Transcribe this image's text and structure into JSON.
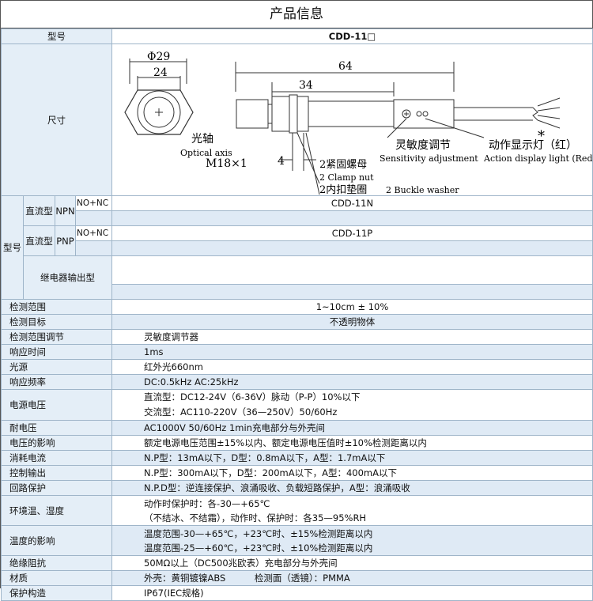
{
  "header": {
    "title": "产品信息"
  },
  "model_row": {
    "label": "型号",
    "value": "CDD-11□"
  },
  "dimension_row": {
    "label": "尺寸",
    "drawing": {
      "dia29": "Φ29",
      "dim24": "24",
      "dim64": "64",
      "dim34": "34",
      "dim4": "4",
      "thread": "M18×1",
      "axis_cn": "光轴",
      "axis_en": "Optical axis",
      "sens_cn": "灵敏度调节",
      "sens_en": "Sensitivity adjustment",
      "action_cn": "动作显示灯（红）",
      "action_en": "Action display light (Red",
      "star": "*",
      "nut_cn": "2紧固螺母",
      "nut_en": "2 Clamp nut",
      "washer_cn": "2内扣垫圈",
      "washer_en": "2 Buckle washer"
    }
  },
  "models": {
    "label": "型号",
    "dc_label": "直流型",
    "npn": "NPN",
    "pnp": "PNP",
    "nonc": "NO+NC",
    "npn_model": "CDD-11N",
    "pnp_model": "CDD-11P",
    "relay_label": "继电器输出型"
  },
  "specs": [
    {
      "label": "检测范围",
      "value": "1~10cm ± 10%",
      "center": true
    },
    {
      "label": "检测目标",
      "value": "不透明物体",
      "center": true
    },
    {
      "label": "检测范围调节",
      "value": "灵敏度调节器"
    },
    {
      "label": "响应时间",
      "value": "1ms"
    },
    {
      "label": "光源",
      "value": "红外光660nm"
    },
    {
      "label": "响应频率",
      "value": "DC:0.5kHz AC:25kHz"
    }
  ],
  "power": {
    "label": "电源电压",
    "line1": "直流型：DC12-24V（6-36V）脉动（P-P）10%以下",
    "line2": "交流型：AC110-220V（36—250V）50/60Hz"
  },
  "specs2": [
    {
      "label": "耐电压",
      "value": "AC1000V 50/60Hz 1min充电部分与外壳间"
    },
    {
      "label": "电压的影响",
      "value": "额定电源电压范围±15%以内、额定电源电压值时±10%检测距离以内"
    },
    {
      "label": "消耗电流",
      "value": "N.P型：13mA以下，D型：0.8mA以下，A型：1.7mA以下"
    },
    {
      "label": "控制输出",
      "value": "N.P型：300mA以下，D型：200mA以下，A型：400mA以下"
    },
    {
      "label": "回路保护",
      "value": "N.P.D型：逆连接保护、浪涌吸收、负载短路保护，A型：浪涌吸收"
    }
  ],
  "env": {
    "label": "环境温、湿度",
    "line1": "动作时保护时：各-30—+65℃",
    "line2": "（不结冰、不结霜），动作时、保护时：各35—95%RH"
  },
  "temp": {
    "label": "温度的影响",
    "line1": "温度范围-30—+65℃，+23℃时、±15%检测距离以内",
    "line2": "温度范围-25—+60℃，+23℃时、±10%检测距离以内"
  },
  "specs3": [
    {
      "label": "绝缘阻抗",
      "value": "50MΩ以上（DC500兆欧表）充电部分与外壳间"
    },
    {
      "label": "材质",
      "value": "外壳：黄铜镀镍ABS          检测面（透镜）：PMMA"
    },
    {
      "label": "保护构造",
      "value": "IP67(IEC规格)"
    }
  ]
}
